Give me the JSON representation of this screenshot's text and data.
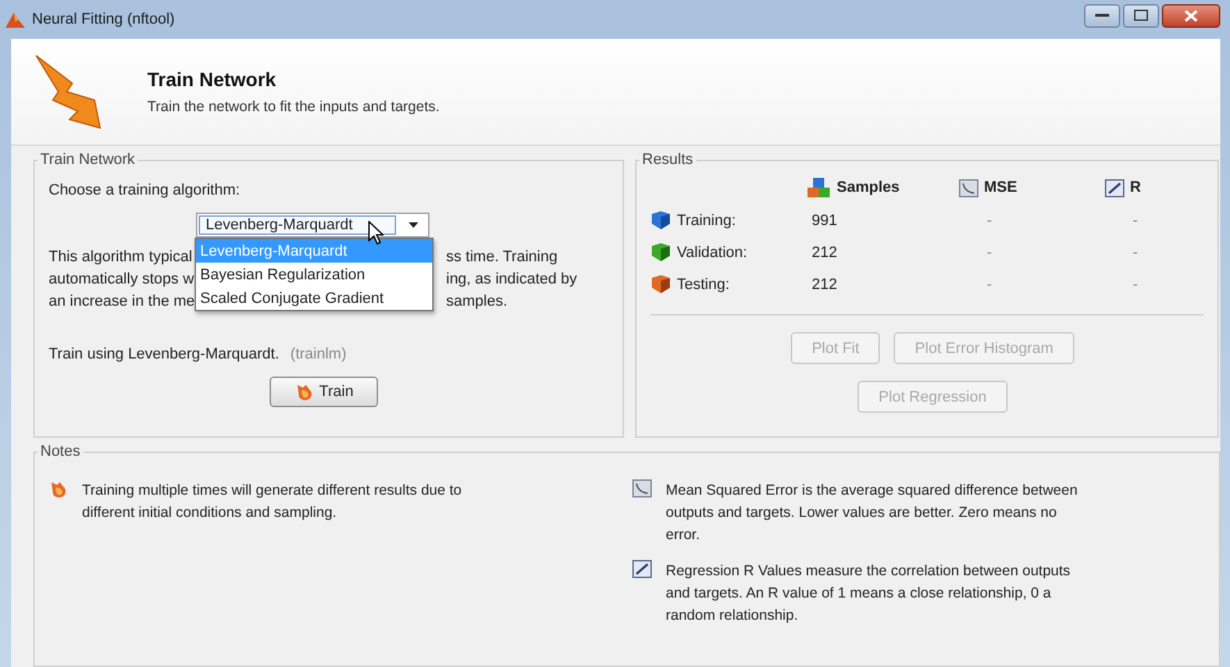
{
  "window": {
    "title": "Neural Fitting (nftool)"
  },
  "header": {
    "title": "Train Network",
    "subtitle": "Train the network to fit the inputs and targets."
  },
  "train_panel": {
    "title": "Train Network",
    "prompt": "Choose a training algorithm:",
    "algorithm": {
      "value": "Levenberg-Marquardt",
      "expanded": true,
      "options": [
        {
          "label": "Levenberg-Marquardt",
          "selected": true
        },
        {
          "label": "Bayesian Regularization",
          "selected": false
        },
        {
          "label": "Scaled Conjugate Gradient",
          "selected": false
        }
      ]
    },
    "description_lines": [
      {
        "left": "This algorithm typical",
        "right": "ss time. Training"
      },
      {
        "left": "automatically stops w",
        "right": "ing, as indicated by"
      },
      {
        "left": "an increase in the me",
        "right": "samples."
      }
    ],
    "train_using": "Train using Levenberg-Marquardt.",
    "function": "(trainlm)",
    "train_button": "Train"
  },
  "results": {
    "title": "Results",
    "columns": [
      {
        "label": "Samples",
        "kind": "samples"
      },
      {
        "label": "MSE",
        "kind": "mse"
      },
      {
        "label": "R",
        "kind": "r"
      }
    ],
    "rows": [
      {
        "label": "Training:",
        "kind": "training",
        "values": [
          "991",
          "-",
          "-"
        ]
      },
      {
        "label": "Validation:",
        "kind": "validation",
        "values": [
          "212",
          "-",
          "-"
        ]
      },
      {
        "label": "Testing:",
        "kind": "testing",
        "values": [
          "212",
          "-",
          "-"
        ]
      }
    ],
    "buttons": [
      [
        {
          "label": "Plot Fit",
          "disabled": true
        },
        {
          "label": "Plot Error Histogram",
          "disabled": true
        }
      ],
      [
        {
          "label": "Plot Regression",
          "disabled": true
        }
      ]
    ]
  },
  "notes": {
    "title": "Notes",
    "items": [
      {
        "kind": "train",
        "text": "Training multiple times will generate different results due to different initial conditions and sampling."
      },
      {
        "kind": "mse",
        "text": "Mean Squared Error is the average squared difference between outputs and targets. Lower values are better. Zero means no error."
      },
      {
        "kind": "r",
        "text": "Regression R Values measure the correlation between outputs and targets. An R value of 1 means a close relationship, 0 a random relationship."
      }
    ]
  }
}
